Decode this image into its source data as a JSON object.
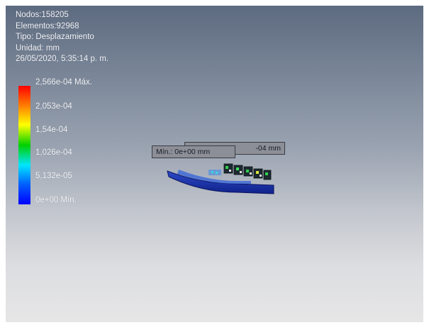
{
  "info": {
    "nodes": "Nodos:158205",
    "elements": "Elementos:92968",
    "type": "Tipo: Desplazamiento",
    "unit": "Unidad: mm",
    "timestamp": "26/05/2020, 5:35:14 p. m."
  },
  "legend": {
    "max": "2,566e-04 Máx.",
    "l2": "2,053e-04",
    "l3": "1,54e-04",
    "l4": "1,026e-04",
    "l5": "5,132e-05",
    "min": "0e+00 Mín.",
    "colors": [
      "#ff0000",
      "#ff8000",
      "#ffff00",
      "#00d000",
      "#00e5ff",
      "#0060ff",
      "#0000ff"
    ]
  },
  "probes": {
    "max_tip": "-04 mm",
    "min_tip": "Mín.: 0e+00 mm"
  }
}
